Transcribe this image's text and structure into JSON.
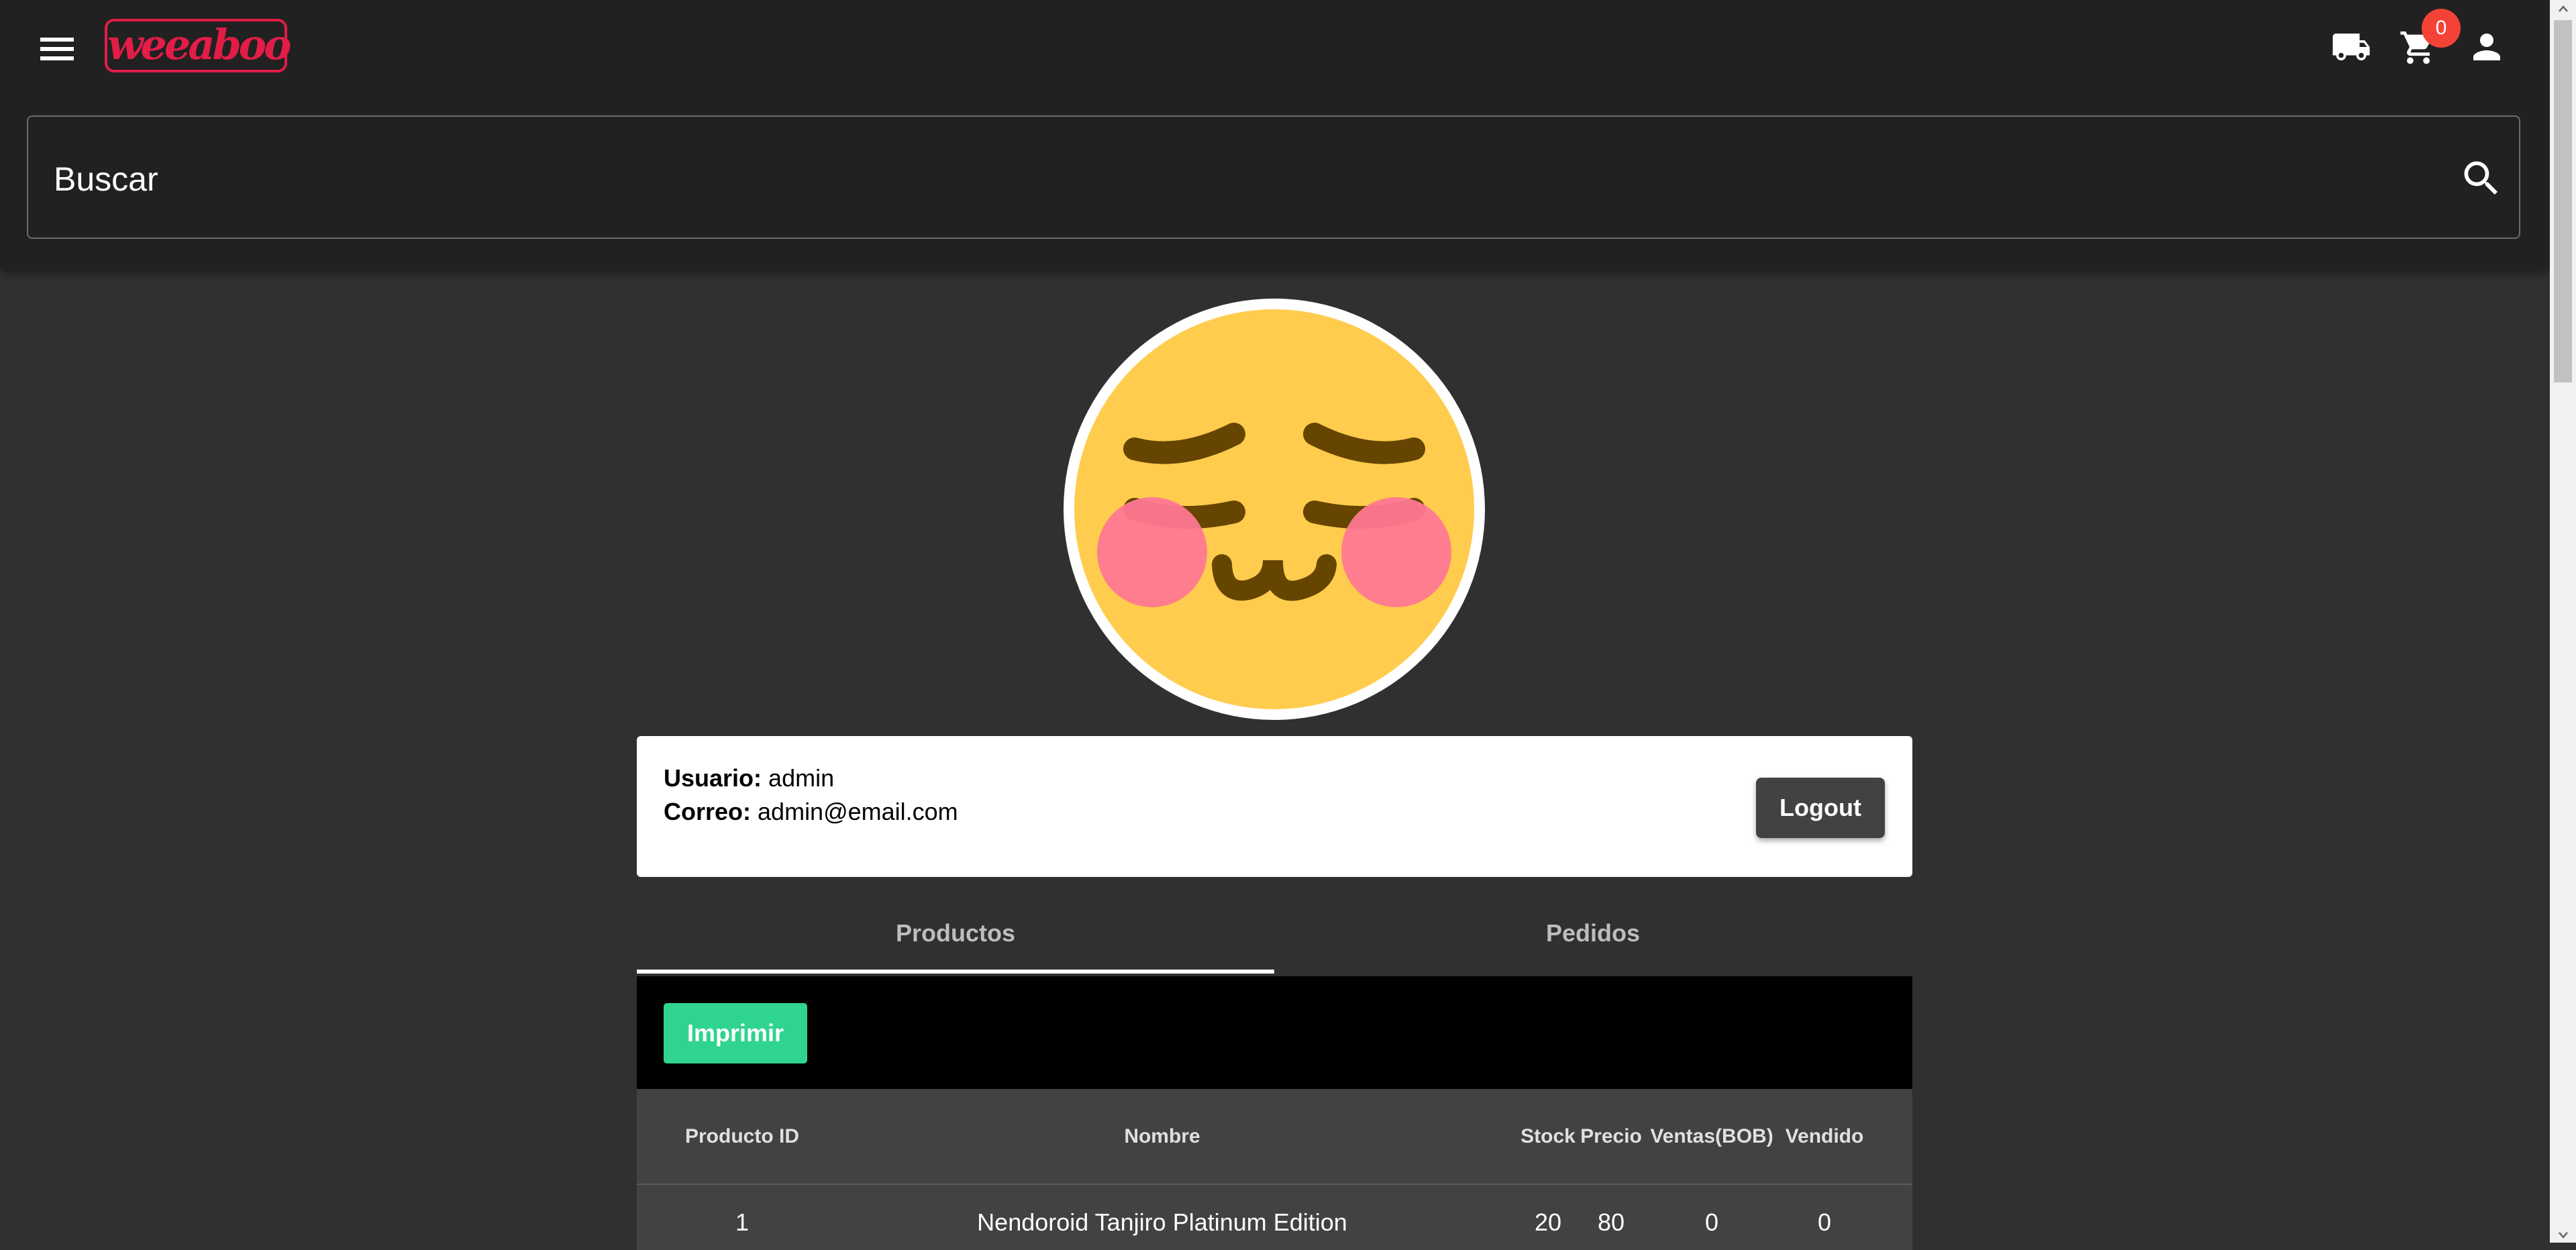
{
  "header": {
    "logo_text": "weeaboo",
    "cart_count": "0",
    "icons": [
      "menu-icon",
      "truck-icon",
      "cart-icon",
      "person-icon"
    ]
  },
  "search": {
    "placeholder": "Buscar",
    "icon": "search-icon"
  },
  "profile": {
    "avatar": "emoji-face-icon",
    "user_label": "Usuario:",
    "user_value": "admin",
    "email_label": "Correo:",
    "email_value": "admin@email.com",
    "logout_label": "Logout"
  },
  "tabs": [
    {
      "label": "Productos",
      "active": true
    },
    {
      "label": "Pedidos",
      "active": false
    }
  ],
  "toolbar": {
    "print_label": "Imprimir"
  },
  "table": {
    "columns": [
      "Producto ID",
      "Nombre",
      "Stock",
      "Precio",
      "Ventas(BOB)",
      "Vendido"
    ],
    "rows": [
      [
        "1",
        "Nendoroid Tanjiro Platinum Edition",
        "20",
        "80",
        "0",
        "0"
      ]
    ]
  },
  "colors": {
    "background": "#303030",
    "topbar": "#212121",
    "brand": "#e11d48",
    "badge": "#f44336",
    "print_button": "#2fd48e"
  }
}
